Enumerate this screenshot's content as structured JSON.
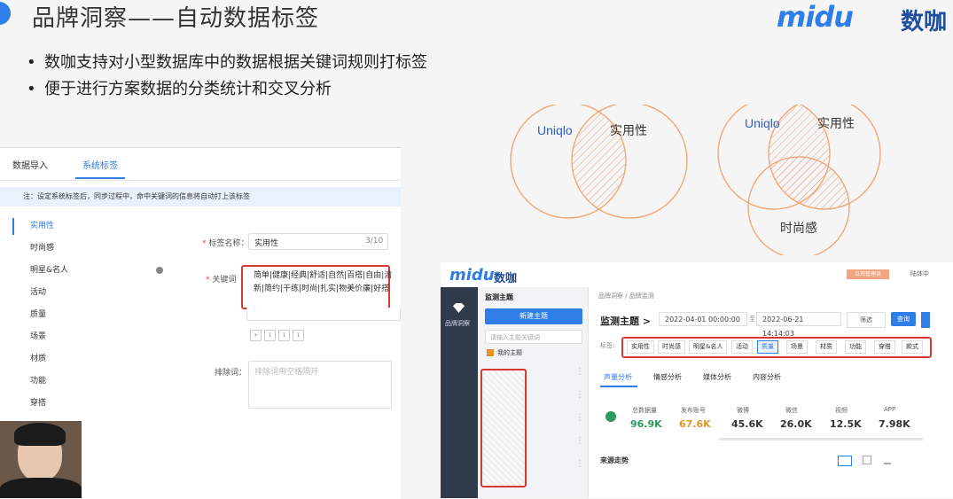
{
  "slide": {
    "title": "品牌洞察——自动数据标签",
    "logo": "midu",
    "logo_cn": "数咖",
    "bullets": [
      "数咖支持对小型数据库中的数据根据关键词规则打标签",
      "便于进行方案数据的分类统计和交叉分析"
    ]
  },
  "left_panel": {
    "tabs": [
      "数据导入",
      "系统标签"
    ],
    "note": "注：设定系统标签后，同步过程中，命中关键词的信息将自动打上该标签",
    "tags": [
      "实用性",
      "时尚感",
      "明星&名人",
      "活动",
      "质量",
      "场景",
      "材质",
      "功能",
      "穿搭"
    ],
    "form": {
      "name_label": "标签名称：",
      "name_value": "实用性",
      "name_count": "3/10",
      "kw_label": "关键词",
      "kw_value": "简单|健康|经典|舒适|自然|百搭|自由|清新|简约|干练|时尚|扎实|物美价廉|好搭",
      "pager": [
        "+",
        "1",
        "1",
        "1"
      ],
      "exclude_label": "排除词：",
      "exclude_placeholder": "排除词用空格隔开"
    }
  },
  "venn": {
    "left": {
      "a": "Uniqlo",
      "b": "实用性"
    },
    "right": {
      "a": "Uniqlo",
      "b": "实用性",
      "c": "时尚感"
    }
  },
  "monitor": {
    "logo": "midu",
    "logo_cn": "数咖",
    "corp_badge": "公司管理员",
    "user": "陆体中",
    "side_label": "品牌洞察",
    "nav_title": "监测主题",
    "new_btn": "新建主题",
    "search_placeholder": "请输入主题关键词",
    "my_topics": "我的主题",
    "crumb": "品牌洞察 / 品牌监测",
    "title": "监测主题 >",
    "date_start": "2022-04-01 00:00:00",
    "date_sep": "至",
    "date_end": "2022-06-21 14:14:03",
    "filter": "筛选",
    "query": "查询",
    "tag_label": "标签:",
    "chips": [
      "实用性",
      "时尚感",
      "明星&名人",
      "活动",
      "质量",
      "场景",
      "材质",
      "功能",
      "穿搭",
      "款式"
    ],
    "subtabs": [
      "声量分析",
      "情感分析",
      "媒体分析",
      "内容分析"
    ],
    "stats": [
      {
        "label": "总数据量",
        "value": "96.9K"
      },
      {
        "label": "发布账号",
        "value": "67.6K"
      },
      {
        "label": "微博",
        "value": "45.6K"
      },
      {
        "label": "微信",
        "value": "26.0K"
      },
      {
        "label": "视频",
        "value": "12.5K"
      },
      {
        "label": "APP",
        "value": "7.98K"
      }
    ],
    "trend": "来源走势",
    "colors": {
      "green": "#2b9a5e",
      "orange": "#e8932c",
      "dark": "#333333"
    }
  }
}
